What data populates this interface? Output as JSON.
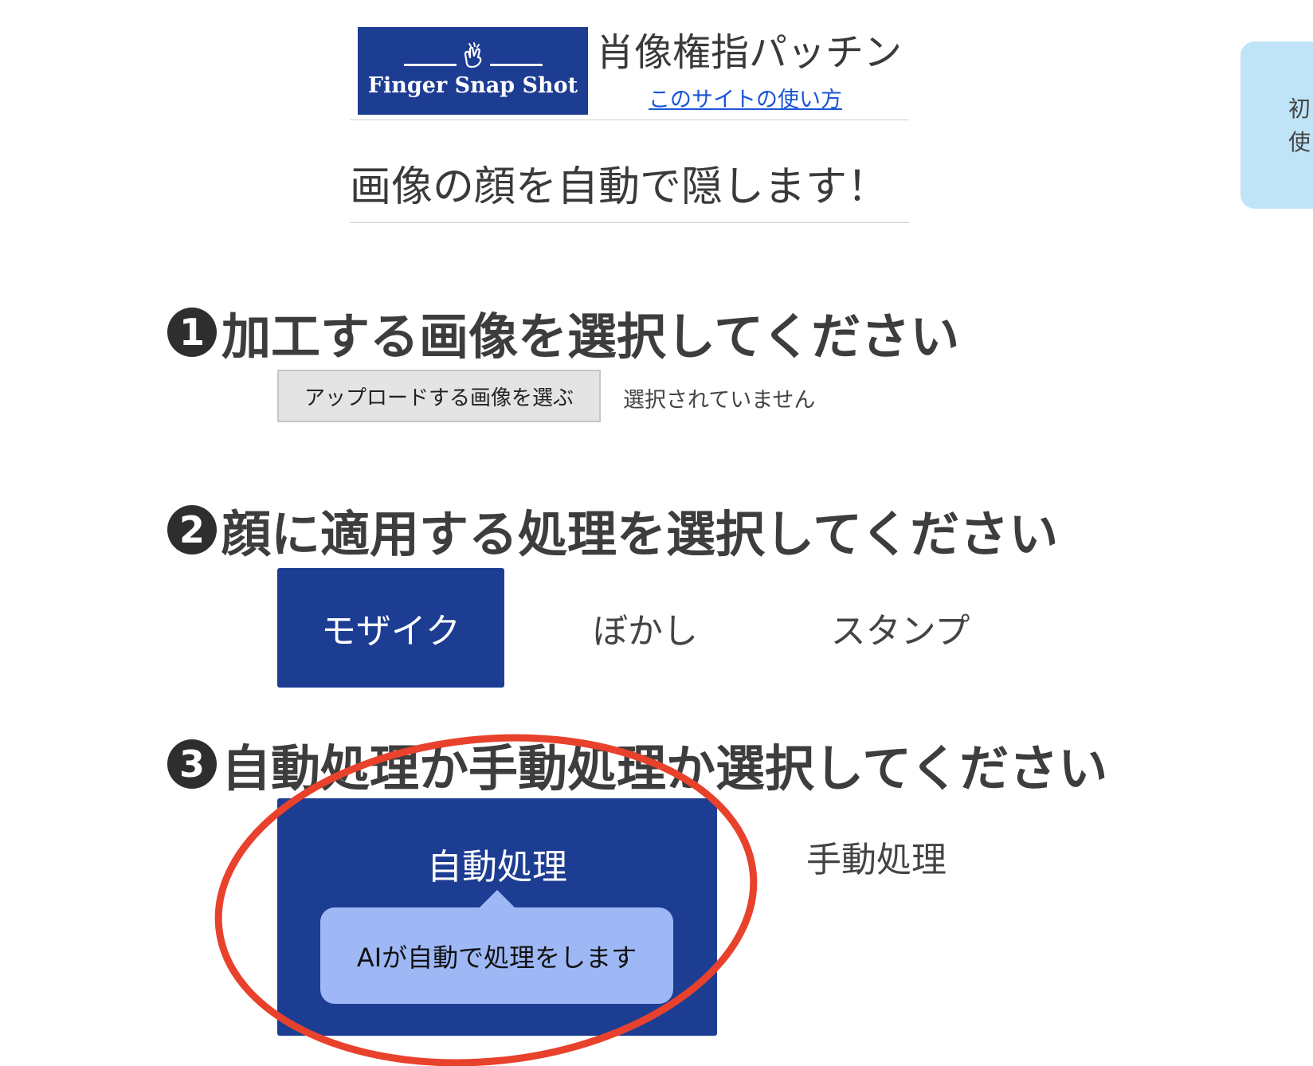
{
  "header": {
    "logo_text": "Finger Snap Shot",
    "site_name": "肖像権指パッチン",
    "howto_link": "このサイトの使い方",
    "tagline": "画像の顔を自動で隠します！"
  },
  "side_tab": {
    "chars": [
      "初",
      "使"
    ],
    "color": "#bfe4f8"
  },
  "steps": [
    {
      "number": "1",
      "title": "加工する画像を選択してください"
    },
    {
      "number": "2",
      "title": "顔に適用する処理を選択してください"
    },
    {
      "number": "3",
      "title": "自動処理か手動処理か選択してください"
    }
  ],
  "upload": {
    "button_label": "アップロードする画像を選ぶ",
    "status": "選択されていません"
  },
  "effect_options": [
    {
      "label": "モザイク",
      "selected": true
    },
    {
      "label": "ぼかし",
      "selected": false
    },
    {
      "label": "スタンプ",
      "selected": false
    }
  ],
  "mode_options": [
    {
      "label": "自動処理",
      "selected": true
    },
    {
      "label": "手動処理",
      "selected": false
    }
  ],
  "tooltip": "AIが自動で処理をします",
  "colors": {
    "brand": "#1d3d93",
    "tooltip": "#9eb8f6",
    "link": "#1a56d6",
    "annotation": "#e8412c"
  }
}
